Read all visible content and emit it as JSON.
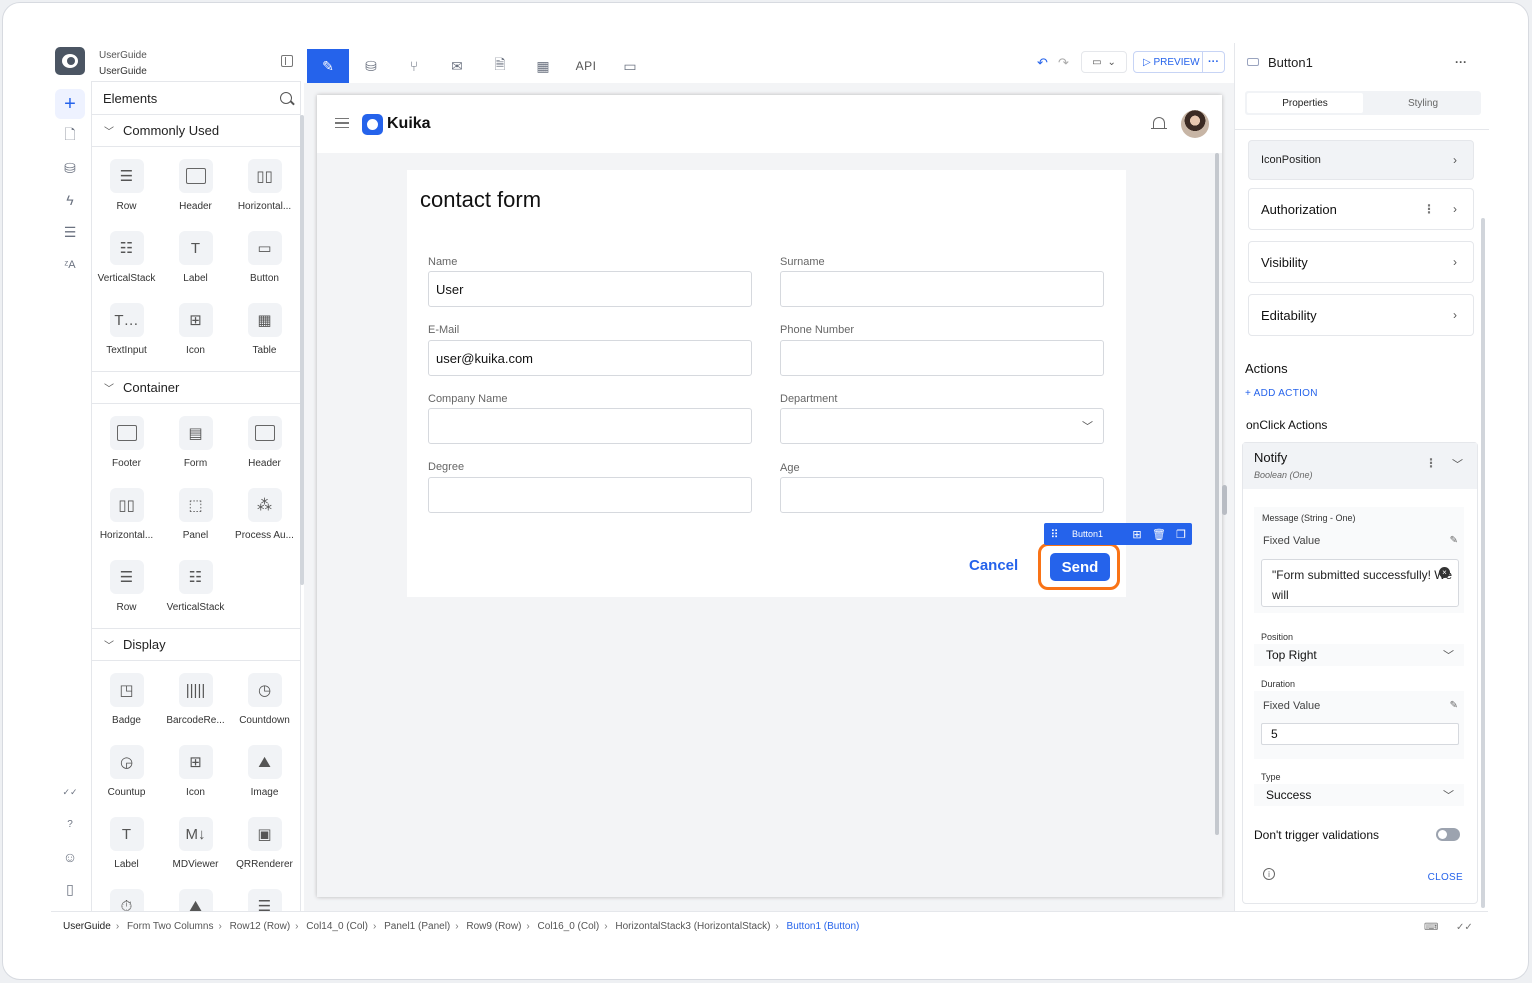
{
  "project": {
    "line1": "UserGuide",
    "line2": "UserGuide"
  },
  "rail": {
    "items": [
      {
        "icon": "plus-icon",
        "glyph": "+"
      },
      {
        "icon": "page-icon",
        "glyph": "🗋"
      },
      {
        "icon": "database-icon",
        "glyph": "⛁"
      },
      {
        "icon": "lightning-icon",
        "glyph": "ϟ"
      },
      {
        "icon": "list-icon",
        "glyph": "☰"
      },
      {
        "icon": "translate-icon",
        "glyph": "ᶻA"
      }
    ],
    "bottom": [
      {
        "icon": "check-double-icon",
        "glyph": "✓✓"
      },
      {
        "icon": "help-icon",
        "glyph": "?"
      },
      {
        "icon": "chat-icon",
        "glyph": "☺"
      },
      {
        "icon": "book-icon",
        "glyph": "▯"
      }
    ]
  },
  "elements": {
    "title": "Elements",
    "sections": {
      "common": {
        "title": "Commonly Used",
        "items": [
          "Row",
          "Header",
          "Horizontal...",
          "VerticalStack",
          "Label",
          "Button",
          "TextInput",
          "Icon",
          "Table"
        ]
      },
      "container": {
        "title": "Container",
        "items": [
          "Footer",
          "Form",
          "Header",
          "Horizontal...",
          "Panel",
          "Process Au...",
          "Row",
          "VerticalStack"
        ]
      },
      "display": {
        "title": "Display",
        "items": [
          "Badge",
          "BarcodeRe...",
          "Countdown",
          "Countup",
          "Icon",
          "Image",
          "Label",
          "MDViewer",
          "QRRenderer"
        ]
      }
    }
  },
  "toolbar": {
    "api_label": "API",
    "preview_label": "▷ PREVIEW",
    "more": "···"
  },
  "app": {
    "brand": "Kuika",
    "form": {
      "title": "contact form",
      "fields": {
        "name_label": "Name",
        "name_value": "User",
        "surname_label": "Surname",
        "surname_value": "",
        "email_label": "E-Mail",
        "email_value": "user@kuika.com",
        "phone_label": "Phone Number",
        "phone_value": "",
        "company_label": "Company Name",
        "company_value": "",
        "department_label": "Department",
        "department_value": "",
        "degree_label": "Degree",
        "degree_value": "",
        "age_label": "Age",
        "age_value": ""
      },
      "cancel_label": "Cancel",
      "send_label": "Send",
      "selected_component": "Button1"
    }
  },
  "properties": {
    "component_name": "Button1",
    "tabs": [
      "Properties",
      "Styling"
    ],
    "icon_position": "IconPosition",
    "authorization": "Authorization",
    "visibility": "Visibility",
    "editability": "Editability",
    "actions_title": "Actions",
    "add_action": "+ ADD ACTION",
    "onclick_title": "onClick Actions",
    "notify": {
      "title": "Notify",
      "subtitle": "Boolean (One)",
      "message_label": "Message (String - One)",
      "message_mode": "Fixed Value",
      "message_value": "\"Form submitted successfully! We will",
      "position_label": "Position",
      "position_value": "Top Right",
      "duration_label": "Duration",
      "duration_mode": "Fixed Value",
      "duration_value": "5",
      "type_label": "Type",
      "type_value": "Success",
      "validations_label": "Don't trigger validations",
      "close_label": "CLOSE"
    }
  },
  "breadcrumb": [
    "UserGuide",
    "Form Two Columns",
    "Row12 (Row)",
    "Col14_0 (Col)",
    "Panel1 (Panel)",
    "Row9 (Row)",
    "Col16_0 (Col)",
    "HorizontalStack3 (HorizontalStack)",
    "Button1 (Button)"
  ]
}
